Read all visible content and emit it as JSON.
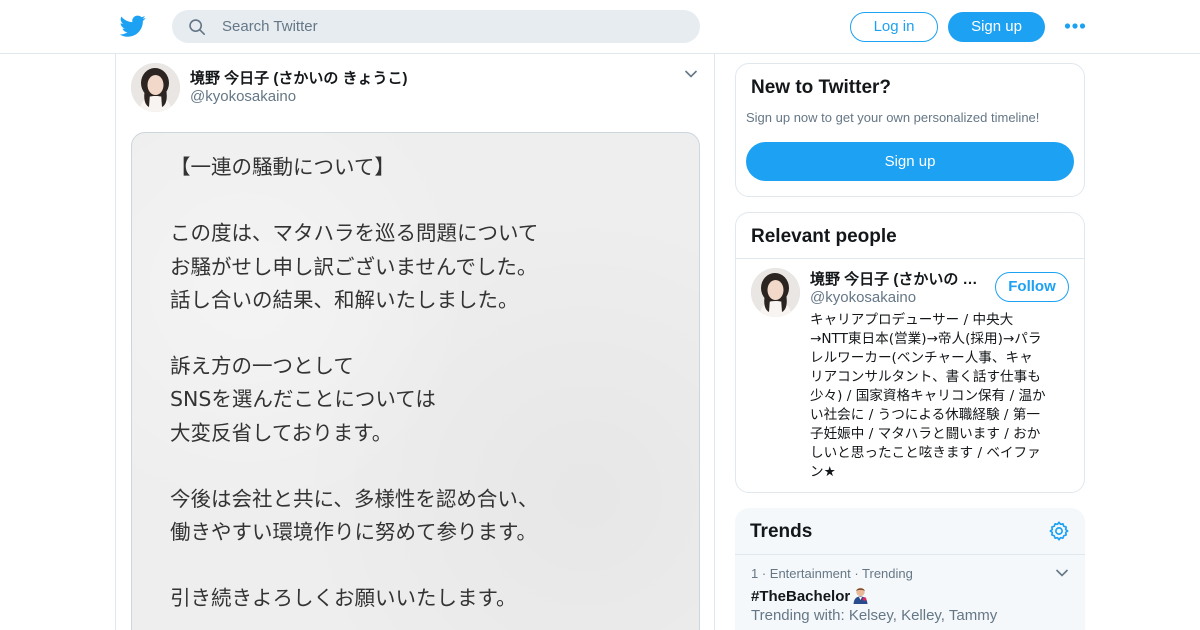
{
  "header": {
    "logo_icon": "twitter-bird-icon",
    "search_placeholder": "Search Twitter",
    "login_label": "Log in",
    "signup_label": "Sign up",
    "more_icon": "more-dots-icon",
    "brand_color": "#1da1f2"
  },
  "tweet": {
    "author_name": "境野 今日子 (さかいの きょうこ)",
    "author_handle": "@kyokosakaino",
    "image_text_lines": [
      "【一連の騒動について】",
      "",
      "この度は、マタハラを巡る問題について",
      "お騒がせし申し訳ございませんでした。",
      "話し合いの結果、和解いたしました。",
      "",
      "訴え方の一つとして",
      "SNSを選んだことについては",
      "大変反省しております。",
      "",
      "今後は会社と共に、多様性を認め合い、",
      "働きやすい環境作りに努めて参ります。",
      "",
      "引き続きよろしくお願いいたします。"
    ]
  },
  "sidebar": {
    "new_to_twitter": {
      "title": "New to Twitter?",
      "subtitle": "Sign up now to get your own personalized timeline!",
      "signup_label": "Sign up"
    },
    "relevant_people": {
      "title": "Relevant people",
      "person": {
        "name": "境野 今日子 (さかいの きょうこ)",
        "handle": "@kyokosakaino",
        "follow_label": "Follow",
        "bio_lines": [
          "キャリアプロデューサー / 中央大",
          "→NTT東日本(営業)→帝人(採用)→パラ",
          "レルワーカー(ベンチャー人事、キャ",
          "リアコンサルタント、書く話す仕事も",
          "少々) / 国家資格キャリコン保有 / 温か",
          "い社会に / うつによる休職経験 / 第一",
          "子妊娠中 / マタハラと闘います / おか",
          "しいと思ったこと呟きます / ベイファ",
          "ン★"
        ]
      }
    },
    "trends": {
      "title": "Trends",
      "items": [
        {
          "meta": "1 · Entertainment · Trending",
          "name": "#TheBachelor",
          "with": "Trending with: Kelsey, Kelley, Tammy"
        }
      ]
    }
  }
}
